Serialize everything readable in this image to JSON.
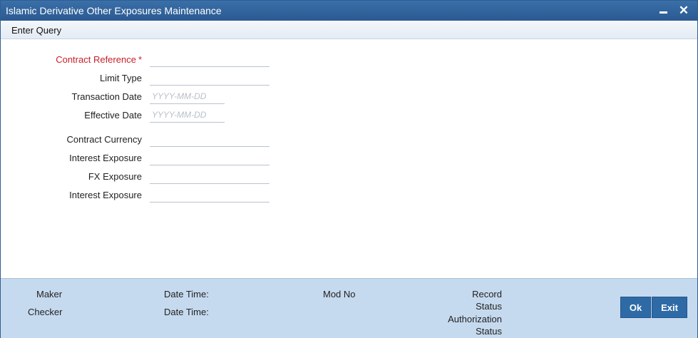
{
  "window": {
    "title": "Islamic Derivative Other Exposures Maintenance",
    "minimize": "",
    "close": "✕"
  },
  "menu": {
    "enter_query": "Enter Query"
  },
  "form": {
    "fields": [
      {
        "label": "Contract Reference",
        "required": true,
        "value": "",
        "placeholder": ""
      },
      {
        "label": "Limit Type",
        "value": "",
        "placeholder": ""
      },
      {
        "label": "Transaction Date",
        "value": "",
        "placeholder": "YYYY-MM-DD"
      },
      {
        "label": "Effective Date",
        "value": "",
        "placeholder": "YYYY-MM-DD"
      },
      {
        "label": "Contract Currency",
        "value": "",
        "placeholder": ""
      },
      {
        "label": "Interest Exposure",
        "value": "",
        "placeholder": ""
      },
      {
        "label": "FX Exposure",
        "value": "",
        "placeholder": ""
      },
      {
        "label": "Interest Exposure",
        "value": "",
        "placeholder": ""
      }
    ],
    "required_marker": "*"
  },
  "footer": {
    "maker": "Maker",
    "checker": "Checker",
    "date_time_1": "Date Time:",
    "date_time_2": "Date Time:",
    "mod_no": "Mod No",
    "record_status_1": "Record",
    "record_status_2": "Status",
    "auth_status_1": "Authorization",
    "auth_status_2": "Status",
    "ok": "Ok",
    "exit": "Exit"
  },
  "colors": {
    "title_bar": "#2b5a91",
    "required": "#c8202a",
    "footer_bg": "#c6daef",
    "button": "#2e6aa6"
  }
}
